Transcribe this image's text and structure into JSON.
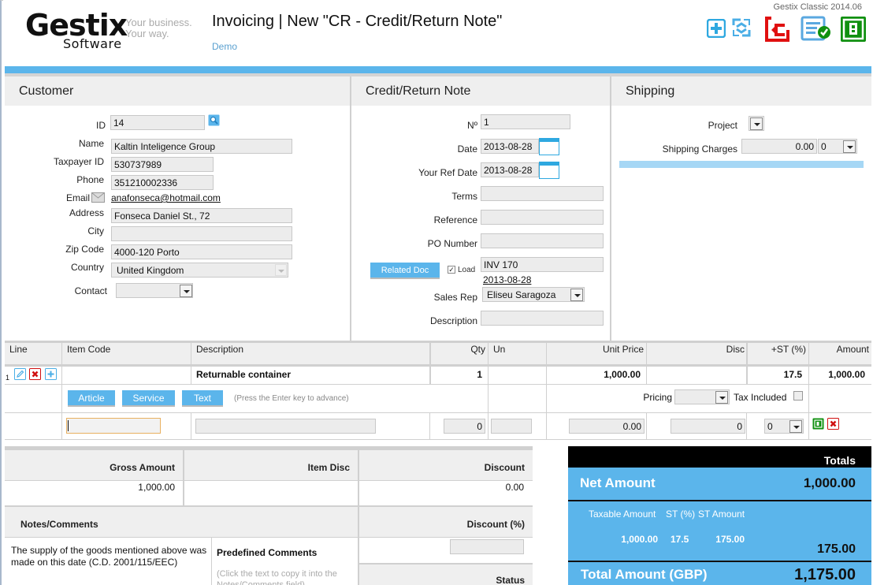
{
  "app": {
    "logo_main": "Gestix",
    "logo_sub": "Software",
    "logo_tagline_1": "Your business.",
    "logo_tagline_2": "Your way.",
    "title": "Invoicing | New \"CR - Credit/Return Note\"",
    "subtitle": "Demo",
    "version": "Gestix Classic 2014.06"
  },
  "toolbar": {
    "icons": [
      "add-icon",
      "refresh-icon",
      "back-exit-icon",
      "validate-document-icon",
      "save-icon"
    ],
    "colors": {
      "add": "#2ea8e0",
      "refresh": "#4aaee6",
      "back": "#e01010",
      "validate": "#5aa8e0",
      "save": "#109010"
    }
  },
  "customer": {
    "heading": "Customer",
    "id_label": "ID",
    "id": "14",
    "name_label": "Name",
    "name": "Kaltin Inteligence Group",
    "taxpayer_label": "Taxpayer ID",
    "taxpayer": "530737989",
    "phone_label": "Phone",
    "phone": "351210002336",
    "email_label": "Email",
    "email": "anafonseca@hotmail.com",
    "address_label": "Address",
    "address": "Fonseca Daniel St., 72",
    "city_label": "City",
    "city": "",
    "zip_label": "Zip Code",
    "zip": "4000-120 Porto",
    "country_label": "Country",
    "country": "United Kingdom",
    "contact_label": "Contact",
    "contact": ""
  },
  "note": {
    "heading": "Credit/Return Note",
    "no_label": "Nº",
    "no": "1",
    "date_label": "Date",
    "date": "2013-08-28",
    "refdate_label": "Your Ref Date",
    "refdate": "2013-08-28",
    "terms_label": "Terms",
    "terms": "",
    "reference_label": "Reference",
    "reference": "",
    "po_label": "PO Number",
    "po": "",
    "related_doc_button": "Related Doc",
    "load_label": "Load",
    "load_checked": true,
    "related_doc": "INV 170",
    "related_doc_date": "2013-08-28",
    "salesrep_label": "Sales Rep",
    "salesrep": "Eliseu Saragoza",
    "description_label": "Description",
    "description": ""
  },
  "shipping": {
    "heading": "Shipping",
    "project_label": "Project",
    "project": "",
    "charges_label": "Shipping Charges",
    "charges": "0.00",
    "charges_tax": "0"
  },
  "lines": {
    "headers": [
      "Line",
      "Item Code",
      "Description",
      "Qty",
      "Un",
      "Unit Price",
      "Disc",
      "+ST (%)",
      "Amount"
    ],
    "rows": [
      {
        "line": "1",
        "item_code": "",
        "description": "Returnable container",
        "qty": "1",
        "un": "",
        "unit_price": "1,000.00",
        "disc": "",
        "st": "17.5",
        "amount": "1,000.00"
      }
    ],
    "type_buttons": [
      "Article",
      "Service",
      "Text"
    ],
    "hint": "(Press the Enter key to advance)",
    "pricing_label": "Pricing",
    "tax_included_label": "Tax Included",
    "tax_included": false,
    "new_row": {
      "item_code": "",
      "description": "",
      "qty": "0",
      "un": "",
      "unit_price": "0.00",
      "disc": "0",
      "st": "0"
    }
  },
  "summary": {
    "gross_label": "Gross Amount",
    "gross": "1,000.00",
    "item_disc_label": "Item Disc",
    "item_disc": "",
    "discount_label": "Discount",
    "discount": "0.00",
    "notes_label": "Notes/Comments",
    "notes": "The supply of the goods mentioned above was made on this date (C.D. 2001/115/EEC)",
    "predef_label": "Predefined Comments",
    "predef_hint": "(Click the text to copy it into the Notes/Comments field)",
    "discount_pct_label": "Discount (%)",
    "discount_pct": "",
    "status_label": "Status"
  },
  "totals": {
    "heading": "Totals",
    "net_label": "Net Amount",
    "net": "1,000.00",
    "taxable_label": "Taxable Amount",
    "st_pct_label": "ST (%)",
    "st_amount_label": "ST Amount",
    "taxable": "1,000.00",
    "st_pct": "17.5",
    "st_amount": "175.00",
    "tax_total": "175.00",
    "total_label": "Total Amount (GBP)",
    "total": "1,175.00"
  }
}
